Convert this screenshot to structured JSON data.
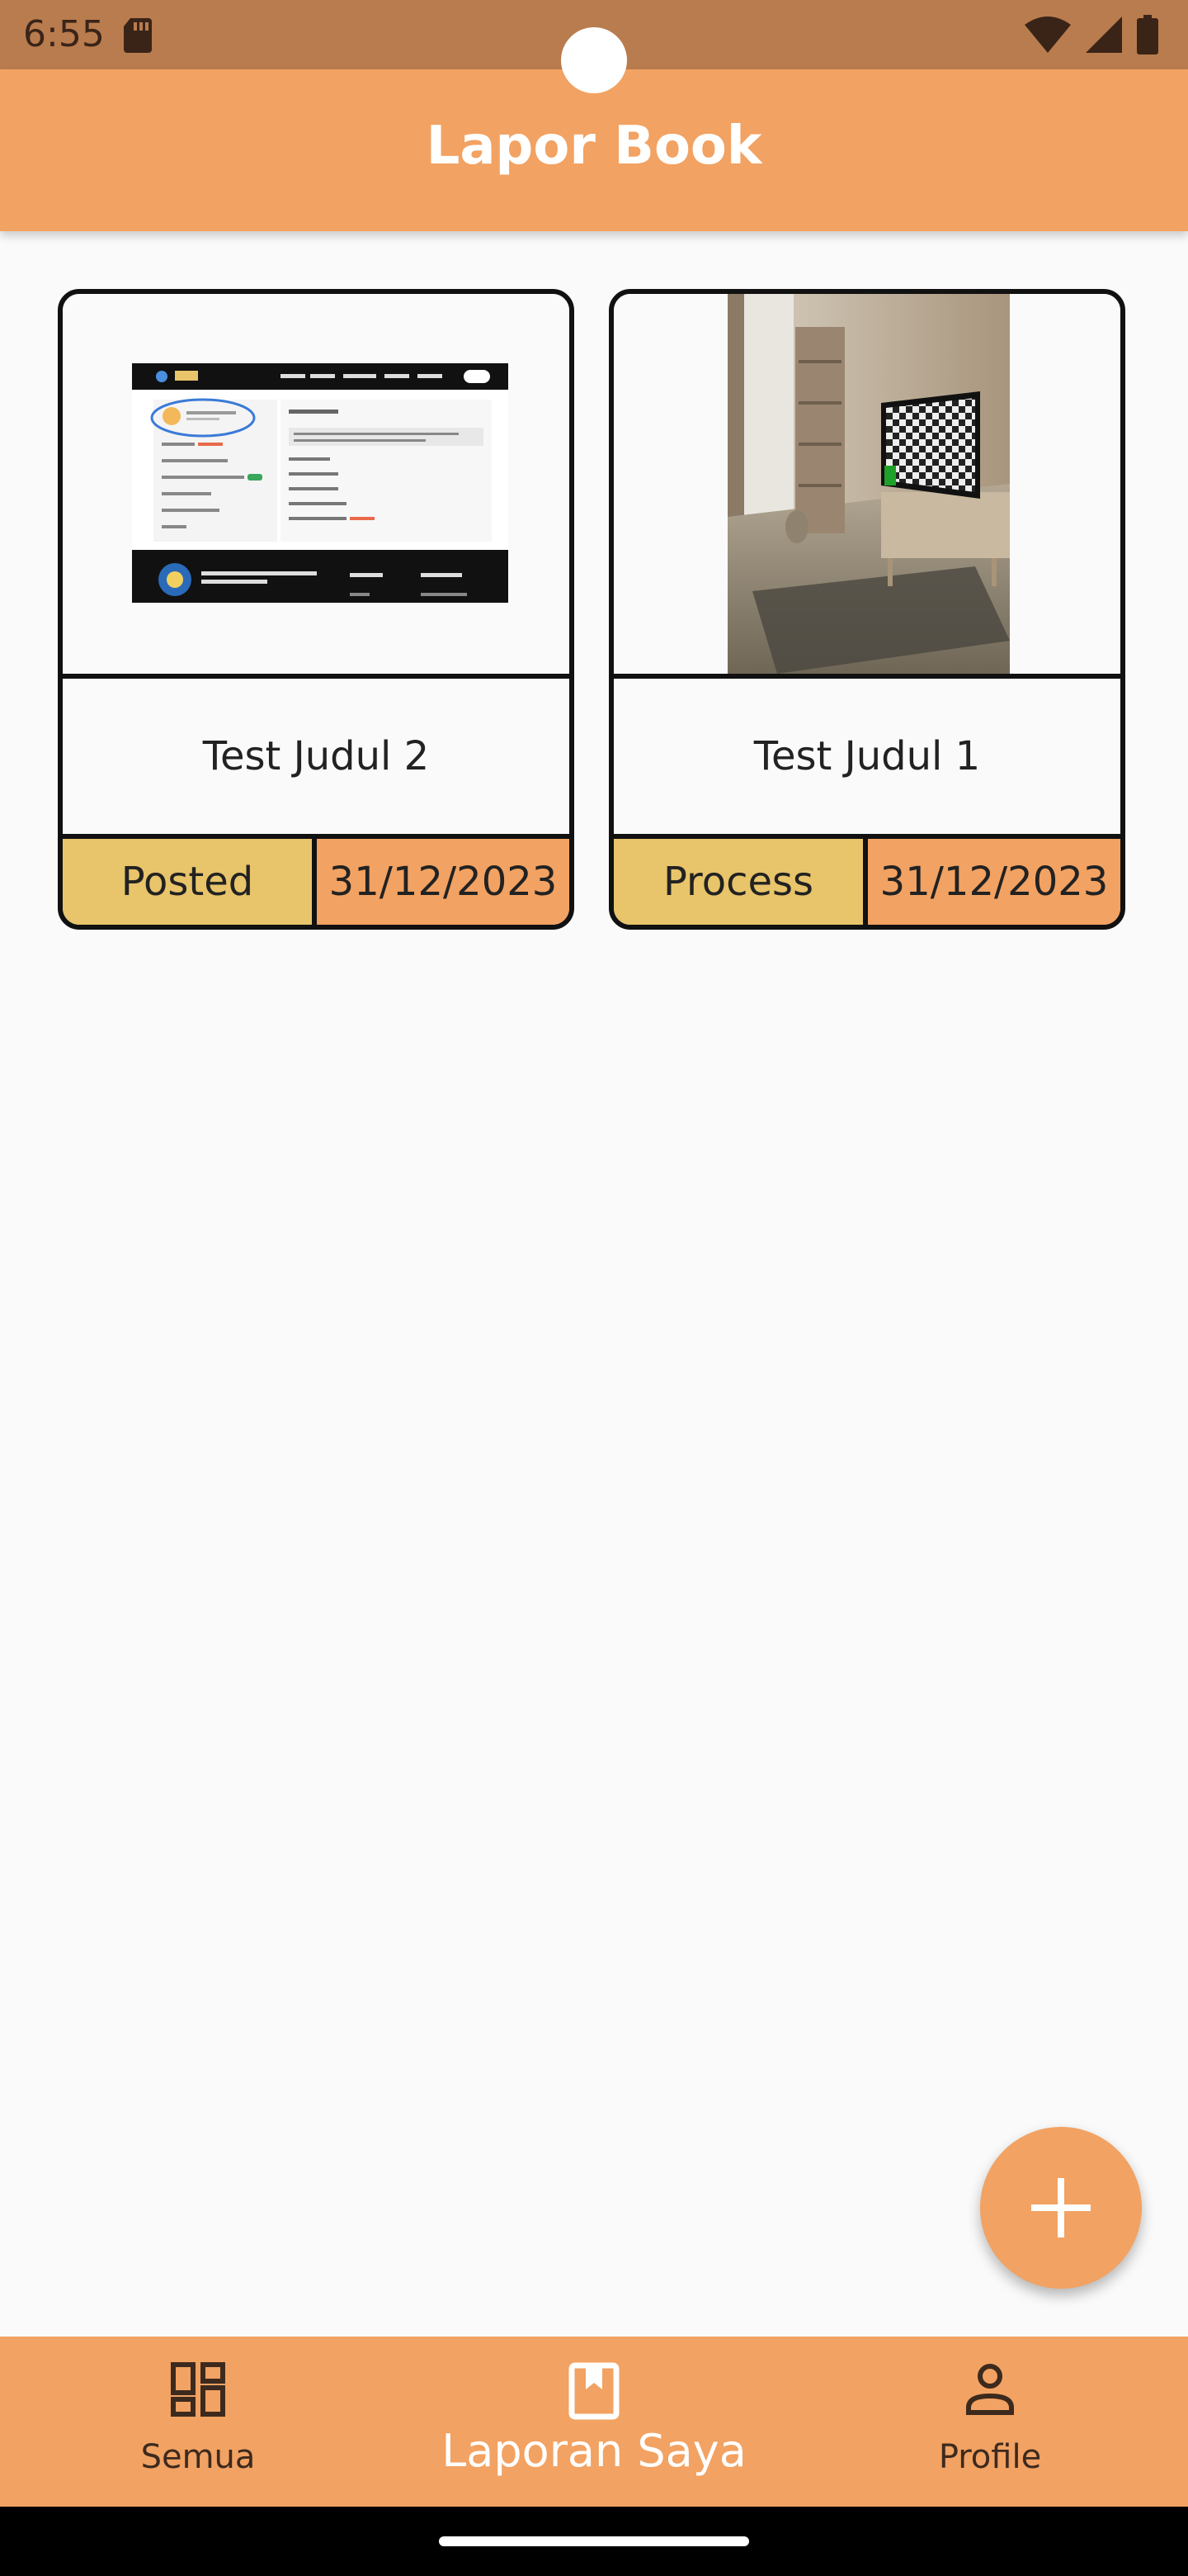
{
  "status_bar": {
    "time": "6:55"
  },
  "app_bar": {
    "title": "Lapor Book"
  },
  "reports": [
    {
      "title": "Test Judul 2",
      "status": "Posted",
      "date": "31/12/2023"
    },
    {
      "title": "Test Judul 1",
      "status": "Process",
      "date": "31/12/2023"
    }
  ],
  "bottom_nav": {
    "items": [
      {
        "label": "Semua",
        "icon": "dashboard-icon"
      },
      {
        "label": "Laporan Saya",
        "icon": "book-icon"
      },
      {
        "label": "Profile",
        "icon": "person-icon"
      }
    ],
    "selected": "Laporan Saya"
  },
  "fab": {
    "icon": "add-icon"
  },
  "colors": {
    "status_bar": "#b97c4e",
    "primary": "#f2a262",
    "status_cell": "#e8c46a",
    "background": "#fafafa"
  }
}
